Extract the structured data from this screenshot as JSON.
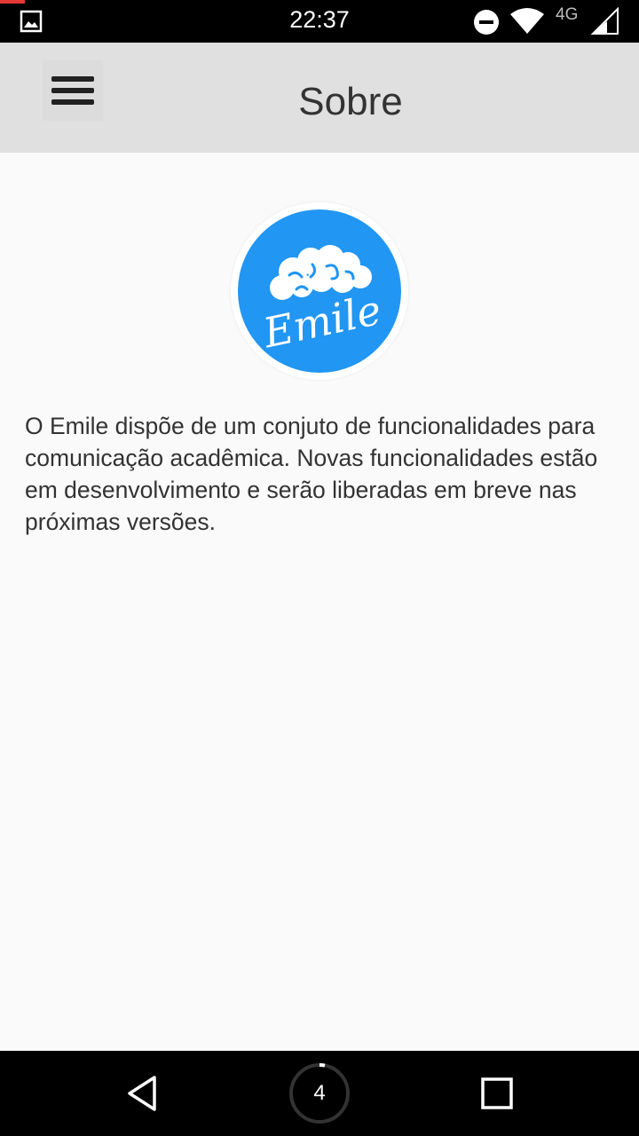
{
  "status_bar": {
    "time": "22:37",
    "network": "4G",
    "icons": [
      "gallery-icon",
      "do-not-disturb-icon",
      "wifi-icon",
      "cell-signal-icon"
    ]
  },
  "app_bar": {
    "title": "Sobre",
    "menu_icon": "hamburger-menu-icon"
  },
  "logo": {
    "text": "Emile",
    "color": "#2196f3"
  },
  "about": {
    "text": "O Emile dispõe de um conjuto de funcionalidades para comunicação acadêmica. Novas funcionalidades estão em desenvolvimento e serão liberadas em breve nas próximas versões."
  },
  "nav_bar": {
    "home_badge": "4",
    "icons": [
      "back-icon",
      "home-icon",
      "recents-icon"
    ]
  },
  "colors": {
    "app_bar": "#e0e0e0",
    "background": "#fafafa",
    "logo_blue": "#2196f3"
  }
}
